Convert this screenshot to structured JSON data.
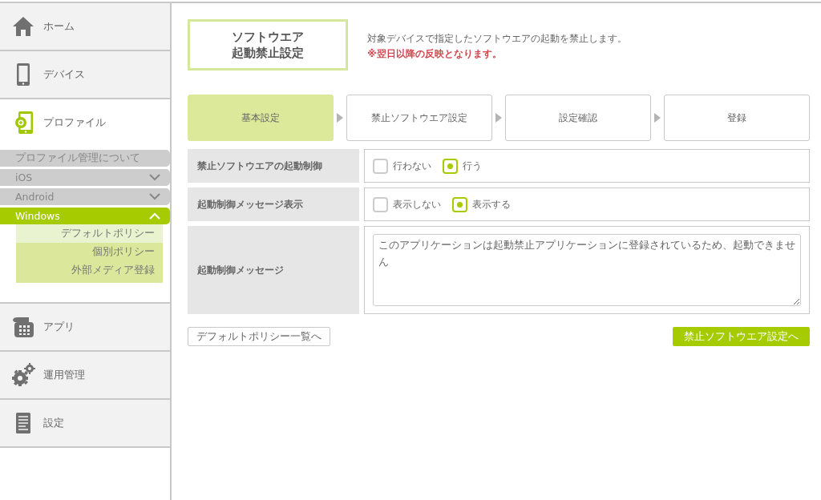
{
  "sidebar": {
    "items": [
      {
        "kind": "home",
        "label": "ホーム",
        "selected": false
      },
      {
        "kind": "device",
        "label": "デバイス",
        "selected": false
      },
      {
        "kind": "profile",
        "label": "プロファイル",
        "selected": true,
        "children": [
          {
            "kind": "link",
            "label": "プロファイル管理について",
            "selected": false
          },
          {
            "kind": "group",
            "label": "iOS",
            "selected": false,
            "expanded": false
          },
          {
            "kind": "group",
            "label": "Android",
            "selected": false,
            "expanded": false
          },
          {
            "kind": "group",
            "label": "Windows",
            "selected": true,
            "expanded": true,
            "children": [
              {
                "label": "デフォルトポリシー",
                "selected": true
              },
              {
                "label": "個別ポリシー",
                "selected": false
              },
              {
                "label": "外部メディア登録",
                "selected": false
              }
            ]
          }
        ]
      },
      {
        "kind": "app",
        "label": "アプリ",
        "selected": false
      },
      {
        "kind": "operation",
        "label": "運用管理",
        "selected": false
      },
      {
        "kind": "settings",
        "label": "設定",
        "selected": false
      }
    ]
  },
  "header": {
    "title_lines": [
      "ソフトウエア",
      "起動禁止設定"
    ],
    "description": "対象デバイスで指定したソフトウエアの起動を禁止します。",
    "notice": "※翌日以降の反映となります。"
  },
  "steps": [
    {
      "label": "基本設定",
      "selected": true
    },
    {
      "label": "禁止ソフトウエア設定",
      "selected": false
    },
    {
      "label": "設定確認",
      "selected": false
    },
    {
      "label": "登録",
      "selected": false
    }
  ],
  "form": {
    "rows": [
      {
        "kind": "radio",
        "label": "禁止ソフトウエアの起動制御",
        "options": [
          {
            "label": "行わない",
            "selected": false
          },
          {
            "label": "行う",
            "selected": true
          }
        ]
      },
      {
        "kind": "radio",
        "label": "起動制御メッセージ表示",
        "options": [
          {
            "label": "表示しない",
            "selected": false
          },
          {
            "label": "表示する",
            "selected": true
          }
        ]
      },
      {
        "kind": "textarea",
        "label": "起動制御メッセージ",
        "value": "このアプリケーションは起動禁止アプリケーションに登録されているため、起動できません"
      }
    ]
  },
  "buttons": [
    {
      "kind": "secondary",
      "label": "デフォルトポリシー一覧へ"
    },
    {
      "kind": "primary",
      "label": "禁止ソフトウエア設定へ"
    }
  ]
}
